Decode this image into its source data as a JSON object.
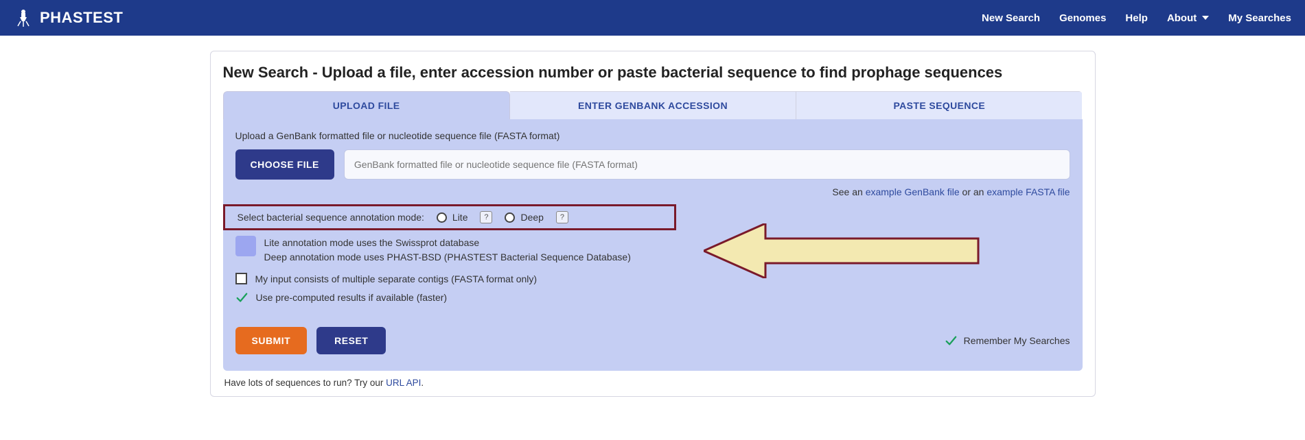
{
  "header": {
    "brand": "PHASTEST",
    "nav": [
      "New Search",
      "Genomes",
      "Help",
      "About",
      "My Searches"
    ]
  },
  "page": {
    "title": "New Search - Upload a file, enter accession number or paste bacterial sequence to find prophage sequences"
  },
  "tabs": {
    "upload": "UPLOAD FILE",
    "accession": "ENTER GENBANK ACCESSION",
    "paste": "PASTE SEQUENCE"
  },
  "upload_panel": {
    "instruction": "Upload a GenBank formatted file or nucleotide sequence file (FASTA format)",
    "choose_file_label": "CHOOSE FILE",
    "file_placeholder": "GenBank formatted file or nucleotide sequence file (FASTA format)",
    "example_prefix": "See an ",
    "example_genbank": "example GenBank file",
    "example_or": " or an ",
    "example_fasta": "example FASTA file",
    "mode_label": "Select bacterial sequence annotation mode:",
    "lite_label": "Lite",
    "deep_label": "Deep",
    "help_char": "?",
    "lite_desc": "Lite annotation mode uses the Swissprot database",
    "deep_desc": "Deep annotation mode uses PHAST-BSD (PHASTEST Bacterial Sequence Database)",
    "contigs_label": "My input consists of multiple separate contigs (FASTA format only)",
    "precomputed_label": "Use pre-computed results if available (faster)",
    "submit_label": "SUBMIT",
    "reset_label": "RESET",
    "remember_label": "Remember My Searches"
  },
  "footer": {
    "text": "Have lots of sequences to run? Try our ",
    "link": "URL API",
    "suffix": "."
  }
}
